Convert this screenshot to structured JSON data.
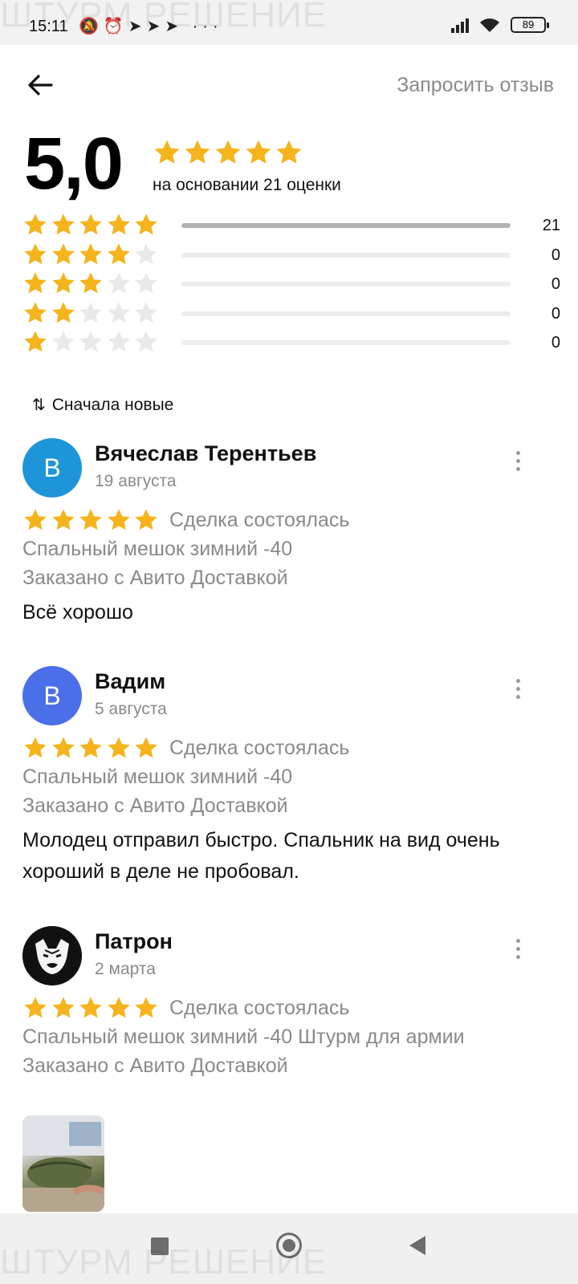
{
  "status_bar": {
    "time": "15:11",
    "icons": [
      "mute-notifications-icon",
      "alarm-icon",
      "telegram-icon",
      "telegram-icon",
      "telegram-icon",
      "more-dots"
    ],
    "icons_text": "🔕⏰➤➤➤ ···",
    "battery": "89"
  },
  "watermark": {
    "top": "ШТУРМ РЕШЕНИЕ",
    "bottom": "ШТУРМ РЕШЕНИЕ"
  },
  "header": {
    "back_icon": "arrow-left-icon",
    "request_review_label": "Запросить отзыв"
  },
  "summary": {
    "rating": "5,0",
    "stars": 5,
    "basis_text": "на основании 21 оценки"
  },
  "distribution": [
    {
      "stars": 5,
      "count": "21",
      "fraction": 1.0
    },
    {
      "stars": 4,
      "count": "0",
      "fraction": 0
    },
    {
      "stars": 3,
      "count": "0",
      "fraction": 0
    },
    {
      "stars": 2,
      "count": "0",
      "fraction": 0
    },
    {
      "stars": 1,
      "count": "0",
      "fraction": 0
    }
  ],
  "sort": {
    "icon": "sort-arrows-icon",
    "label": "Сначала новые"
  },
  "colors": {
    "star_filled": "#f5b41c",
    "star_empty": "#e9e9e9",
    "avatar_1": "#1e95d9",
    "avatar_2": "#4b6fe8",
    "muted_text": "#8a8a8a"
  },
  "reviews": [
    {
      "avatar_letter": "В",
      "name": "Вячеслав Терентьев",
      "date": "19 августа",
      "stars": 5,
      "deal_status": "Сделка состоялась",
      "item": "Спальный мешок зимний -40",
      "delivery": "Заказано с Авито Доставкой",
      "text": "Всё хорошо"
    },
    {
      "avatar_letter": "В",
      "name": "Вадим",
      "date": "5 августа",
      "stars": 5,
      "deal_status": "Сделка состоялась",
      "item": "Спальный мешок зимний -40",
      "delivery": "Заказано с Авито Доставкой",
      "text": "Молодец отправил быстро. Спальник на вид очень хороший в деле не пробовал."
    },
    {
      "avatar_icon": "pitbull-dog-avatar",
      "name": "Патрон",
      "date": "2 марта",
      "stars": 5,
      "deal_status": "Сделка состоялась",
      "item": "Спальный мешок зимний -40 Штурм для армии",
      "delivery": "Заказано с Авито Доставкой",
      "photo": "sleeping-bag-photo-thumbnail"
    }
  ],
  "nav_bar": {
    "buttons": [
      "recent-apps-square",
      "home-circle",
      "back-triangle"
    ]
  }
}
